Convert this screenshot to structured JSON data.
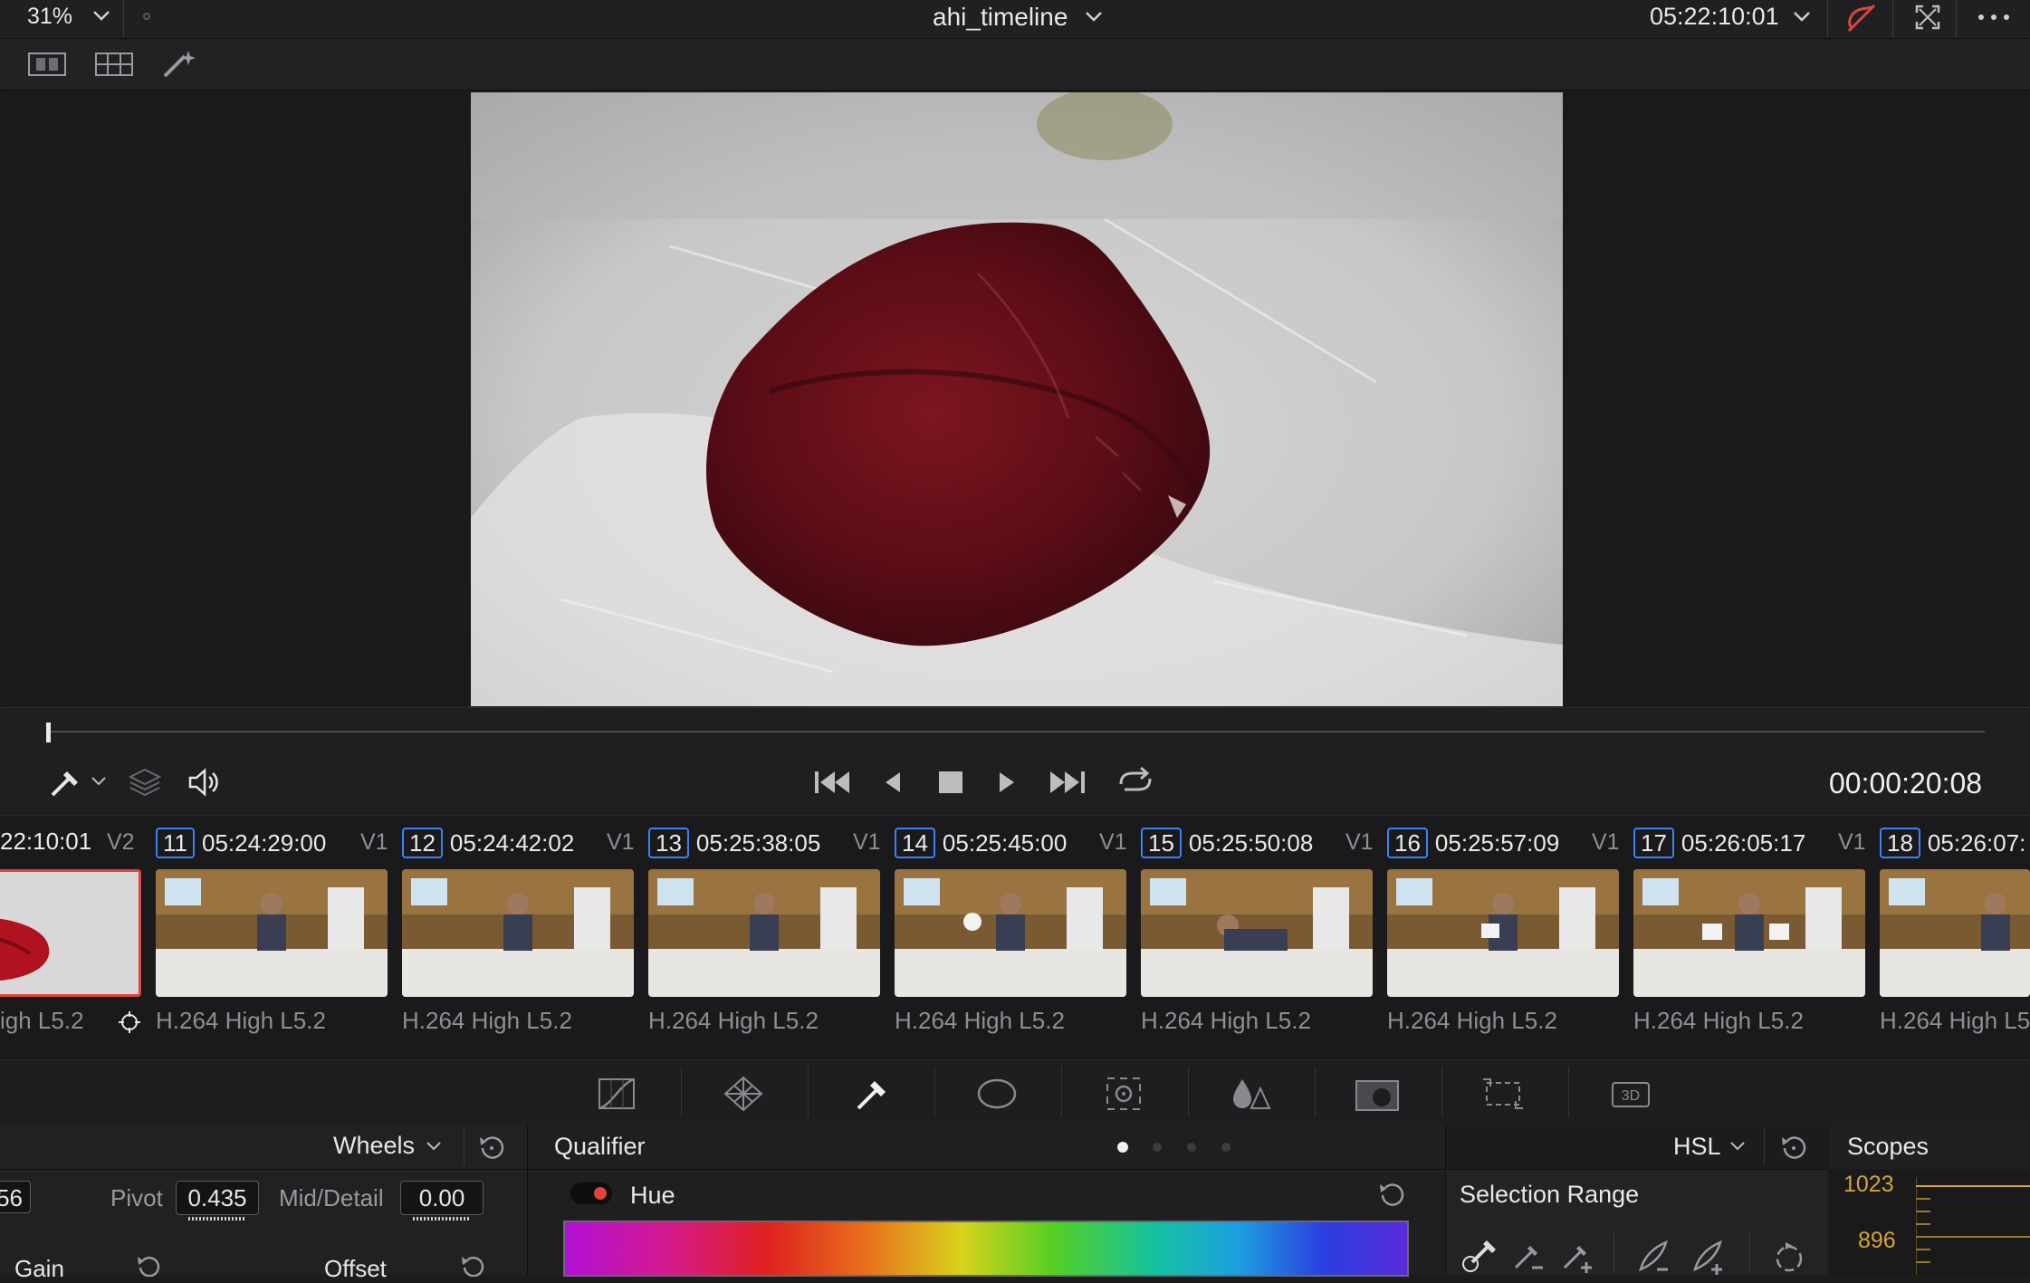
{
  "top": {
    "zoom": "31%",
    "timeline_name": "ahi_timeline",
    "timecode": "05:22:10:01"
  },
  "viewer": {
    "playhead_timecode": "00:00:20:08"
  },
  "clips": [
    {
      "num": "",
      "timecode": "22:10:01",
      "track": "V2",
      "codec": "igh L5.2",
      "type": "tuna",
      "selected": true
    },
    {
      "num": "11",
      "timecode": "05:24:29:00",
      "track": "V1",
      "codec": "H.264 High L5.2",
      "type": "kitchen"
    },
    {
      "num": "12",
      "timecode": "05:24:42:02",
      "track": "V1",
      "codec": "H.264 High L5.2",
      "type": "kitchen"
    },
    {
      "num": "13",
      "timecode": "05:25:38:05",
      "track": "V1",
      "codec": "H.264 High L5.2",
      "type": "kitchen"
    },
    {
      "num": "14",
      "timecode": "05:25:45:00",
      "track": "V1",
      "codec": "H.264 High L5.2",
      "type": "kitchen"
    },
    {
      "num": "15",
      "timecode": "05:25:50:08",
      "track": "V1",
      "codec": "H.264 High L5.2",
      "type": "kitchen"
    },
    {
      "num": "16",
      "timecode": "05:25:57:09",
      "track": "V1",
      "codec": "H.264 High L5.2",
      "type": "kitchen"
    },
    {
      "num": "17",
      "timecode": "05:26:05:17",
      "track": "V1",
      "codec": "H.264 High L5.2",
      "type": "kitchen"
    },
    {
      "num": "18",
      "timecode": "05:26:07:",
      "track": "",
      "codec": "H.264 High L5",
      "type": "kitchen"
    }
  ],
  "left_panel": {
    "mode": "Wheels",
    "partial_value": "56",
    "pivot_label": "Pivot",
    "pivot_value": "0.435",
    "middetail_label": "Mid/Detail",
    "middetail_value": "0.00",
    "gain_label": "Gain",
    "offset_label": "Offset"
  },
  "qualifier": {
    "title": "Qualifier",
    "mode": "HSL",
    "hue_label": "Hue",
    "selection_range": "Selection Range"
  },
  "scopes": {
    "title": "Scopes",
    "ticks": [
      "1023",
      "896"
    ]
  },
  "colors": {
    "accent_blue": "#3b82f6",
    "selected_red": "#e0443a",
    "scope_text": "#d4a43a"
  }
}
